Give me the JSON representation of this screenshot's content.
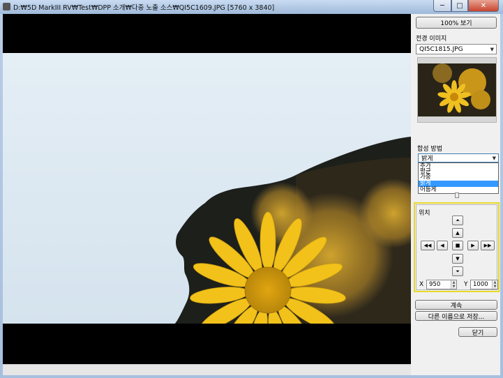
{
  "window": {
    "title": "D:₩5D MarkIII RV₩Test₩DPP 소개₩다중 노출 소스₩QI5C1609.JPG [5760 x 3840]",
    "minimize_glyph": "─",
    "maximize_glyph": "□",
    "close_glyph": "✕"
  },
  "panel": {
    "zoom_button": "100% 보기",
    "foreground_label": "전경 이미지",
    "foreground_file": "QI5C1815.JPG",
    "blend_label": "합성 방법",
    "blend_selected": "밝게",
    "blend_options": [
      "추가",
      "평균",
      "가중",
      "밝게",
      "어둡게"
    ],
    "blend_highlighted_index": 3,
    "position_label": "위치",
    "arrows": {
      "top": "⏶",
      "up": "▲",
      "far_left": "◀◀",
      "left": "◀",
      "center": "■",
      "right": "▶",
      "far_right": "▶▶",
      "down": "▼",
      "bottom": "⏷"
    },
    "x_label": "X",
    "x_value": "950",
    "y_label": "Y",
    "y_value": "1000",
    "continue_button": "계속",
    "save_as_button": "다른 이름으로 저장...",
    "close_button": "닫기"
  }
}
